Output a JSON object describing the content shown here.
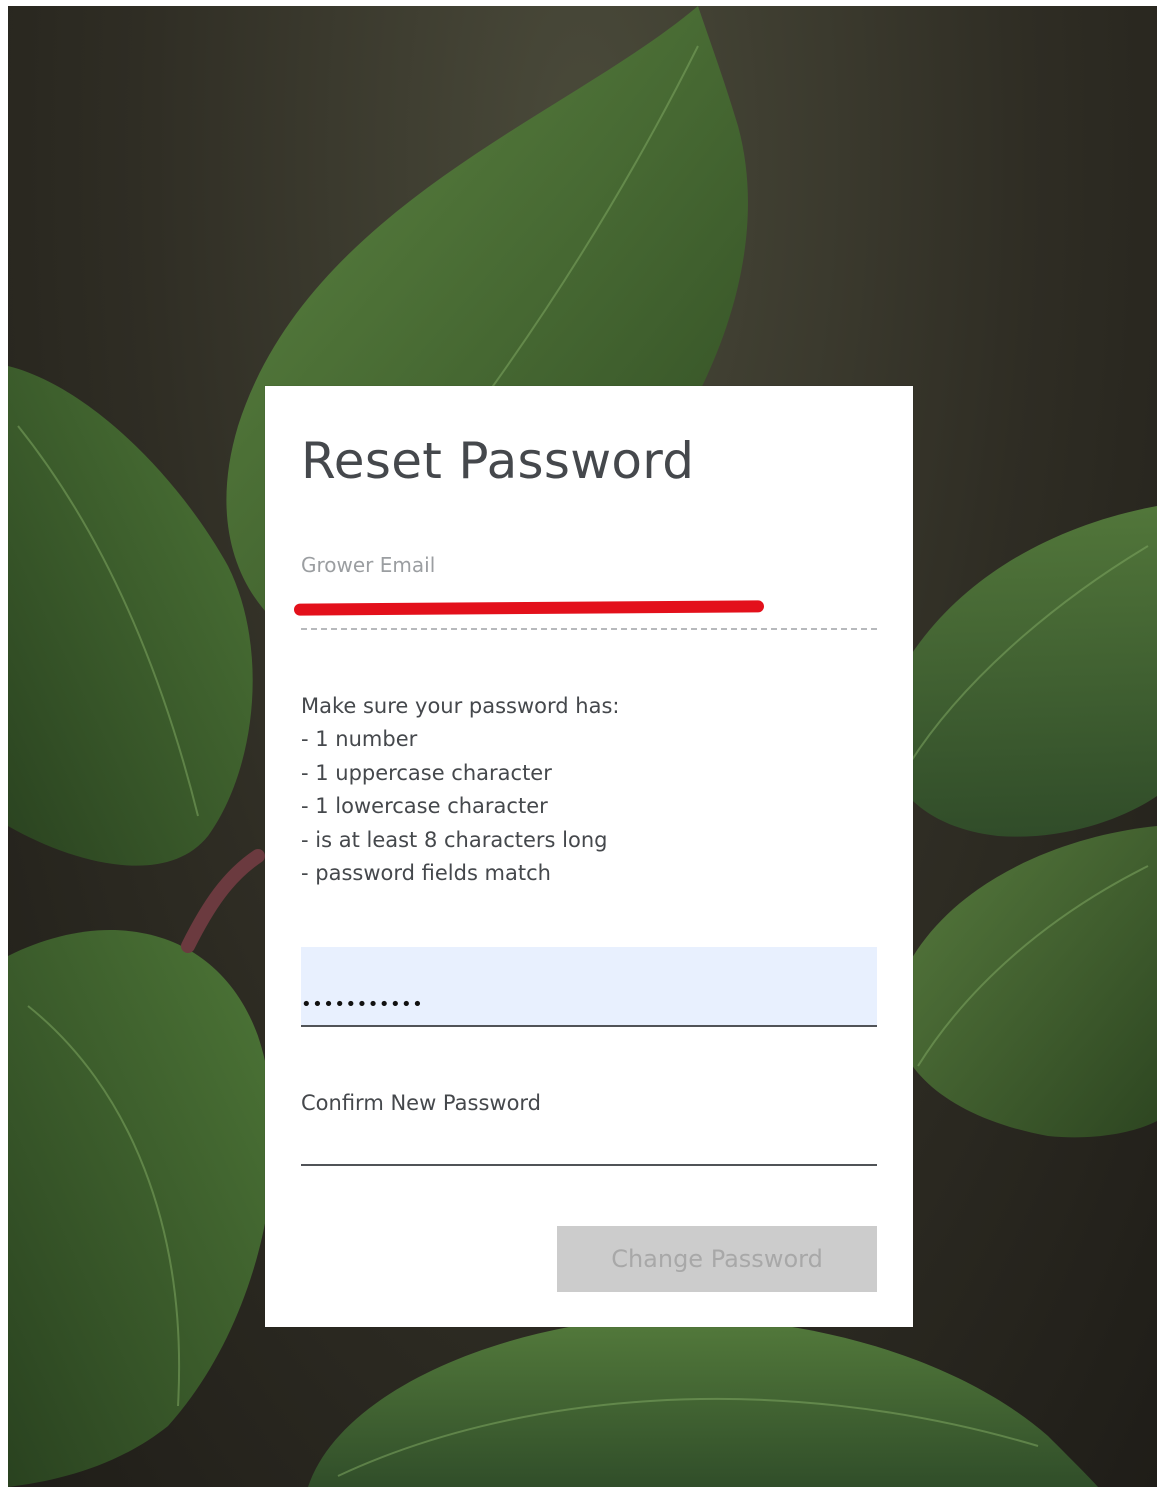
{
  "page": {
    "title": "Reset Password"
  },
  "email": {
    "label": "Grower Email",
    "value": ""
  },
  "requirements": {
    "heading": "Make sure your password has:",
    "items": [
      "- 1 number",
      "- 1 uppercase character",
      "- 1 lowercase character",
      "- is at least 8 characters long",
      "- password fields match"
    ]
  },
  "new_password": {
    "value": "•••••••••••"
  },
  "confirm_password": {
    "label": "Confirm New Password",
    "value": ""
  },
  "actions": {
    "change_password_label": "Change Password"
  },
  "colors": {
    "title_text": "#45484c",
    "label_muted": "#9b9ea1",
    "autofill_bg": "#e8f0fe",
    "redaction": "#e3101b",
    "button_disabled_bg": "#cccccc",
    "button_disabled_text": "#a8a8a8",
    "leaf_green": "#3e5f2c"
  }
}
